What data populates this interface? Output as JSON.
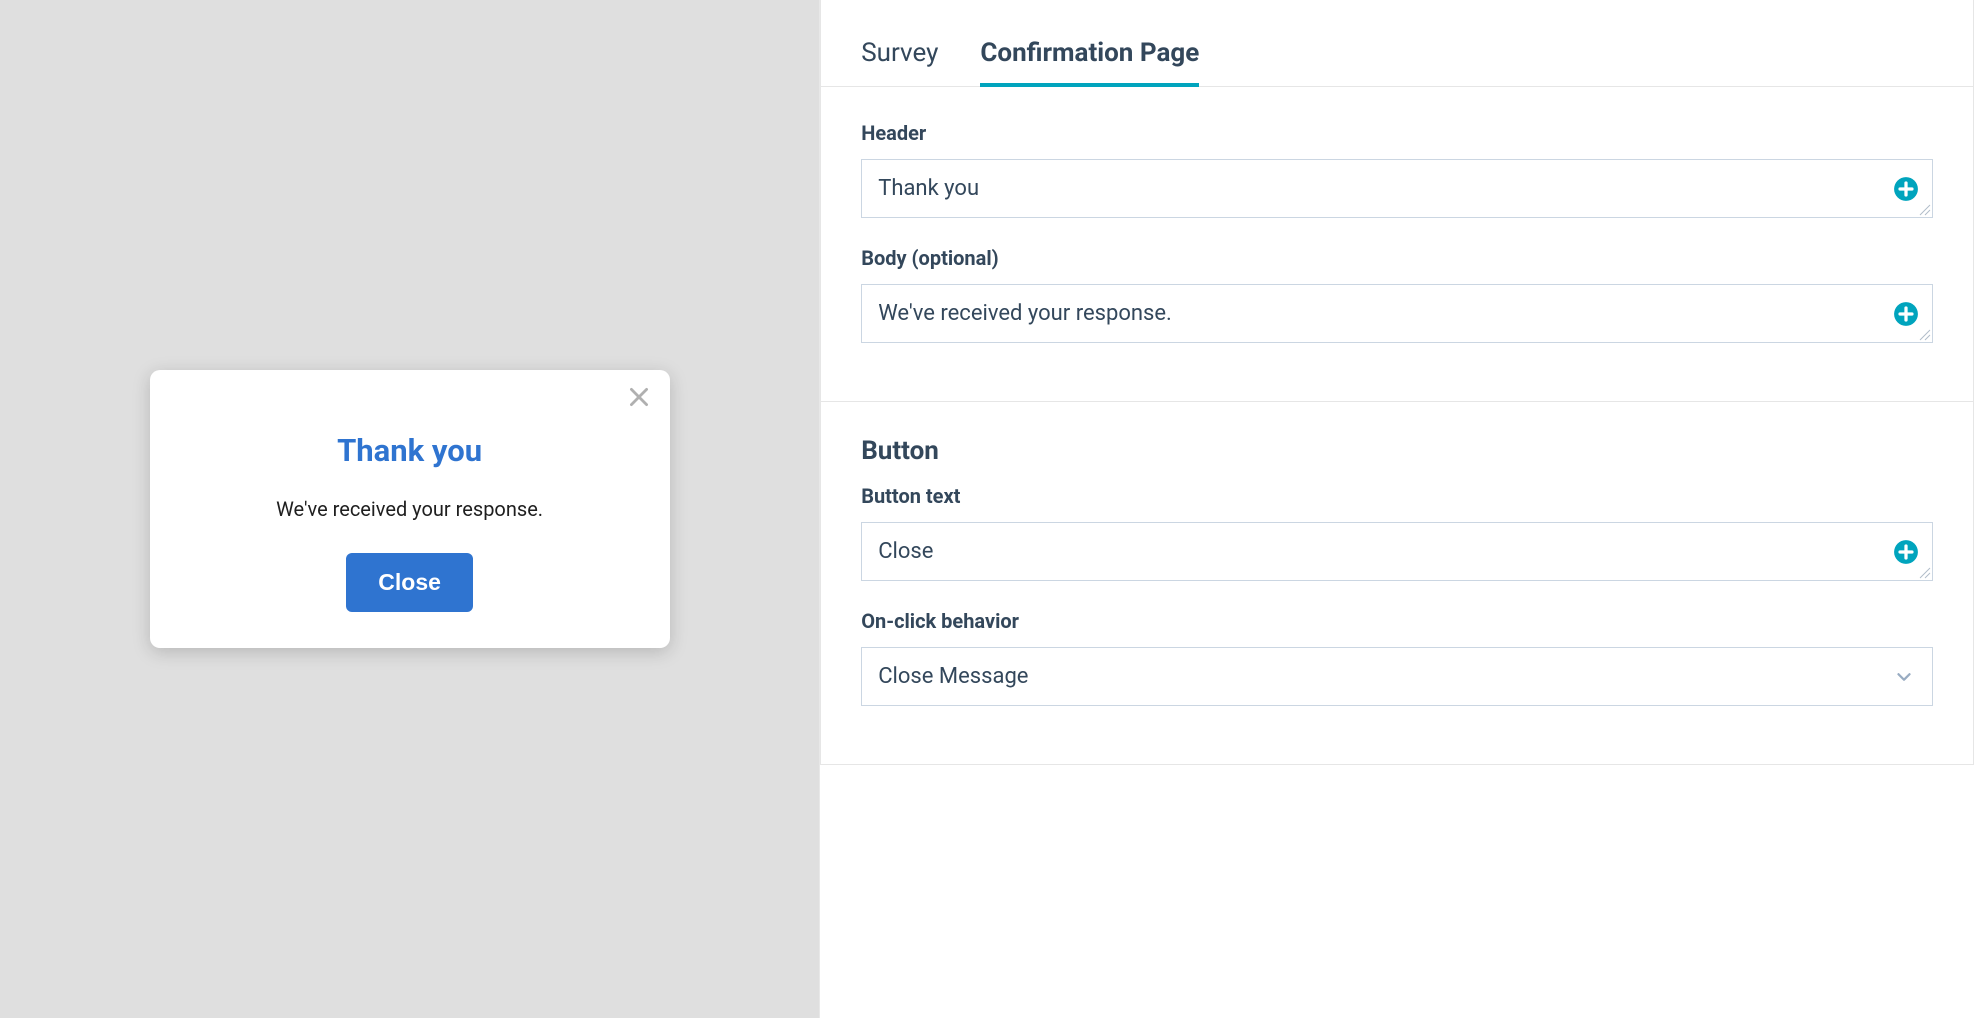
{
  "tabs": {
    "survey": "Survey",
    "confirmation": "Confirmation Page"
  },
  "editor": {
    "header_label": "Header",
    "header_value": "Thank you",
    "body_label": "Body (optional)",
    "body_value": "We've received your response.",
    "button_section_title": "Button",
    "button_text_label": "Button text",
    "button_text_value": "Close",
    "onclick_label": "On-click behavior",
    "onclick_value": "Close Message"
  },
  "preview": {
    "header": "Thank you",
    "body": "We've received your response.",
    "button": "Close"
  }
}
